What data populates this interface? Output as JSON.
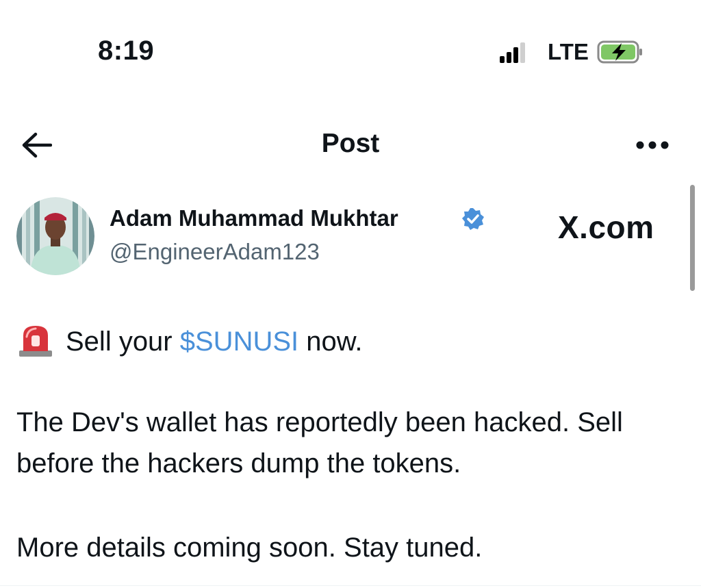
{
  "status_bar": {
    "time": "8:19",
    "network": "LTE",
    "signal_bars": 3,
    "battery_charging": true
  },
  "nav": {
    "title": "Post",
    "back_icon": "arrow-left-icon",
    "more_icon": "ellipsis-icon"
  },
  "author": {
    "name": "Adam Muhammad Mukhtar",
    "handle": "@EngineerAdam123",
    "verified": true,
    "verified_color": "#4a90d9"
  },
  "watermark": "X.com",
  "post": {
    "prefix": "Sell your ",
    "cashtag": "$SUNUSI",
    "suffix": " now.",
    "paragraph1_line1": "The Dev's wallet has reportedly been hacked. Sell",
    "paragraph1_line2": "before the hackers dump the tokens.",
    "paragraph2": "More details coming soon. Stay tuned."
  },
  "colors": {
    "link": "#4a90d9",
    "secondary_text": "#536471",
    "battery_fill": "#7fc765"
  }
}
